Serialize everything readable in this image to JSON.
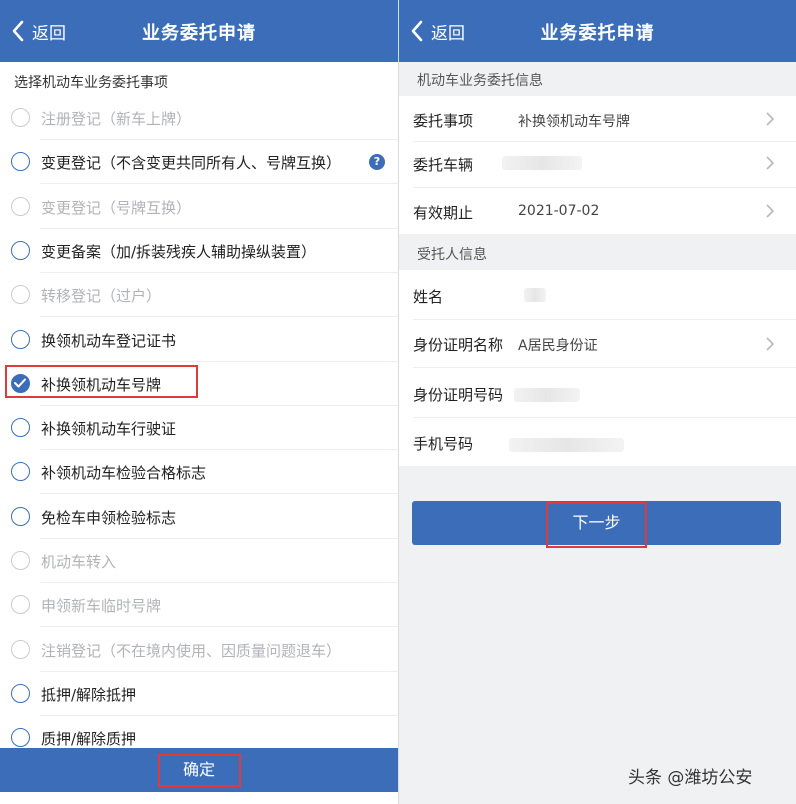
{
  "colors": {
    "primary": "#3b6db8",
    "highlight": "#e03a3a",
    "disabled": "#b0b3b8"
  },
  "left": {
    "header": {
      "back_label": "返回",
      "title": "业务委托申请"
    },
    "section_label": "选择机动车业务委托事项",
    "options": [
      {
        "label": "注册登记（新车上牌）",
        "state": "disabled"
      },
      {
        "label": "变更登记（不含变更共同所有人、号牌互换）",
        "state": "enabled",
        "help": "?"
      },
      {
        "label": "变更登记（号牌互换）",
        "state": "disabled"
      },
      {
        "label": "变更备案（加/拆装残疾人辅助操纵装置）",
        "state": "enabled"
      },
      {
        "label": "转移登记（过户）",
        "state": "disabled"
      },
      {
        "label": "换领机动车登记证书",
        "state": "enabled"
      },
      {
        "label": "补换领机动车号牌",
        "state": "checked"
      },
      {
        "label": "补换领机动车行驶证",
        "state": "enabled"
      },
      {
        "label": "补领机动车检验合格标志",
        "state": "enabled"
      },
      {
        "label": "免检车申领检验标志",
        "state": "enabled"
      },
      {
        "label": "机动车转入",
        "state": "disabled"
      },
      {
        "label": "申领新车临时号牌",
        "state": "disabled"
      },
      {
        "label": "注销登记（不在境内使用、因质量问题退车）",
        "state": "disabled"
      },
      {
        "label": "抵押/解除抵押",
        "state": "enabled"
      },
      {
        "label": "质押/解除质押",
        "state": "enabled"
      }
    ],
    "confirm_label": "确定"
  },
  "right": {
    "header": {
      "back_label": "返回",
      "title": "业务委托申请"
    },
    "vehicle_section": "机动车业务委托信息",
    "vehicle_rows": [
      {
        "key": "委托事项",
        "value": "补换领机动车号牌"
      },
      {
        "key": "委托车辆",
        "value": ""
      },
      {
        "key": "有效期止",
        "value": "2021-07-02"
      }
    ],
    "person_section": "受托人信息",
    "person_rows": [
      {
        "key": "姓名",
        "value": ""
      },
      {
        "key": "身份证明名称",
        "value": "A居民身份证"
      },
      {
        "key": "身份证明号码",
        "value": ""
      },
      {
        "key": "手机号码",
        "value": ""
      }
    ],
    "next_label": "下一步"
  },
  "watermark": "头条 @潍坊公安"
}
